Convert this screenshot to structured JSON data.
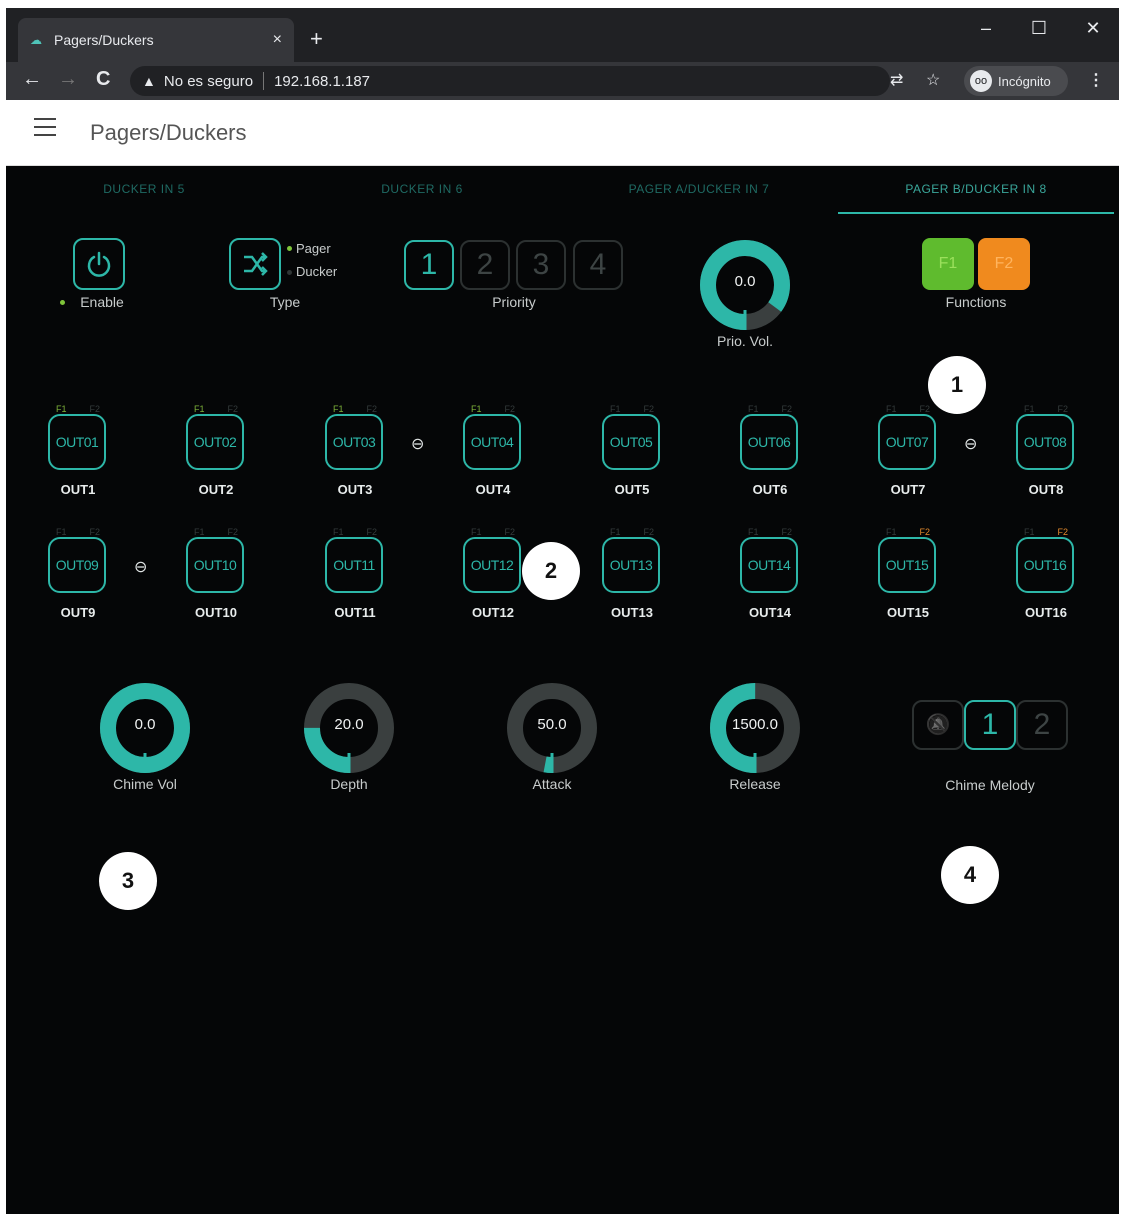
{
  "browser": {
    "tab_title": "Pagers/Duckers",
    "tab_close": "×",
    "new_tab": "+",
    "win_min": "–",
    "win_max": "☐",
    "win_close": "✕",
    "back": "←",
    "forward": "→",
    "reload": "C",
    "security_icon": "▲",
    "security_text": "No es seguro",
    "url": "192.168.1.187",
    "translate_icon": "⇄",
    "star_icon": "☆",
    "incognito_label": "Incógnito",
    "incognito_icon": "oo",
    "menu_icon": "⋮"
  },
  "app": {
    "title": "Pagers/Duckers"
  },
  "tabs": [
    {
      "label": "DUCKER IN 5",
      "active": false
    },
    {
      "label": "DUCKER IN 6",
      "active": false
    },
    {
      "label": "PAGER A/DUCKER IN 7",
      "active": false
    },
    {
      "label": "PAGER B/DUCKER IN 8",
      "active": true
    }
  ],
  "controls": {
    "enable_label": "Enable",
    "type_label": "Type",
    "type_options": [
      "Pager",
      "Ducker"
    ],
    "priority_label": "Priority",
    "priority_options": [
      "1",
      "2",
      "3",
      "4"
    ],
    "priority_selected": "1",
    "prio_vol_value": "0.0",
    "prio_vol_label": "Prio. Vol.",
    "functions_label": "Functions",
    "f1_label": "F1",
    "f2_label": "F2",
    "link_icon": "⊖"
  },
  "outputs": [
    {
      "box": "OUT01",
      "name": "OUT1",
      "f1": "F1",
      "f2": "F2",
      "f1_on": true,
      "f2_on": false
    },
    {
      "box": "OUT02",
      "name": "OUT2",
      "f1": "F1",
      "f2": "F2",
      "f1_on": true,
      "f2_on": false
    },
    {
      "box": "OUT03",
      "name": "OUT3",
      "f1": "F1",
      "f2": "F2",
      "f1_on": true,
      "f2_on": false
    },
    {
      "box": "OUT04",
      "name": "OUT4",
      "f1": "F1",
      "f2": "F2",
      "f1_on": true,
      "f2_on": false
    },
    {
      "box": "OUT05",
      "name": "OUT5",
      "f1": "F1",
      "f2": "F2",
      "f1_on": false,
      "f2_on": false
    },
    {
      "box": "OUT06",
      "name": "OUT6",
      "f1": "F1",
      "f2": "F2",
      "f1_on": false,
      "f2_on": false
    },
    {
      "box": "OUT07",
      "name": "OUT7",
      "f1": "F1",
      "f2": "F2",
      "f1_on": false,
      "f2_on": false
    },
    {
      "box": "OUT08",
      "name": "OUT8",
      "f1": "F1",
      "f2": "F2",
      "f1_on": false,
      "f2_on": false
    },
    {
      "box": "OUT09",
      "name": "OUT9",
      "f1": "F1",
      "f2": "F2",
      "f1_on": false,
      "f2_on": false
    },
    {
      "box": "OUT10",
      "name": "OUT10",
      "f1": "F1",
      "f2": "F2",
      "f1_on": false,
      "f2_on": false
    },
    {
      "box": "OUT11",
      "name": "OUT11",
      "f1": "F1",
      "f2": "F2",
      "f1_on": false,
      "f2_on": false
    },
    {
      "box": "OUT12",
      "name": "OUT12",
      "f1": "F1",
      "f2": "F2",
      "f1_on": false,
      "f2_on": false
    },
    {
      "box": "OUT13",
      "name": "OUT13",
      "f1": "F1",
      "f2": "F2",
      "f1_on": false,
      "f2_on": false
    },
    {
      "box": "OUT14",
      "name": "OUT14",
      "f1": "F1",
      "f2": "F2",
      "f1_on": false,
      "f2_on": false
    },
    {
      "box": "OUT15",
      "name": "OUT15",
      "f1": "F1",
      "f2": "F2",
      "f1_on": false,
      "f2_on": true
    },
    {
      "box": "OUT16",
      "name": "OUT16",
      "f1": "F1",
      "f2": "F2",
      "f1_on": false,
      "f2_on": true
    }
  ],
  "knobs": {
    "prio_vol": {
      "value": "0.0",
      "fraction": 0.85
    },
    "chime_vol": {
      "value": "0.0",
      "label": "Chime Vol",
      "fraction": 1.0
    },
    "depth": {
      "value": "20.0",
      "label": "Depth",
      "fraction": 0.25
    },
    "attack": {
      "value": "50.0",
      "label": "Attack",
      "fraction": 0.03
    },
    "release": {
      "value": "1500.0",
      "label": "Release",
      "fraction": 0.5
    }
  },
  "chime_melody": {
    "label": "Chime Melody",
    "mute_icon": "🔕",
    "options": [
      "1",
      "2"
    ],
    "selected": "1"
  },
  "callouts": [
    "1",
    "2",
    "3",
    "4"
  ],
  "colors": {
    "accent": "#2db7a8",
    "f1_green": "#5fbb2e",
    "f2_orange": "#f08a1e",
    "background": "#050607"
  }
}
